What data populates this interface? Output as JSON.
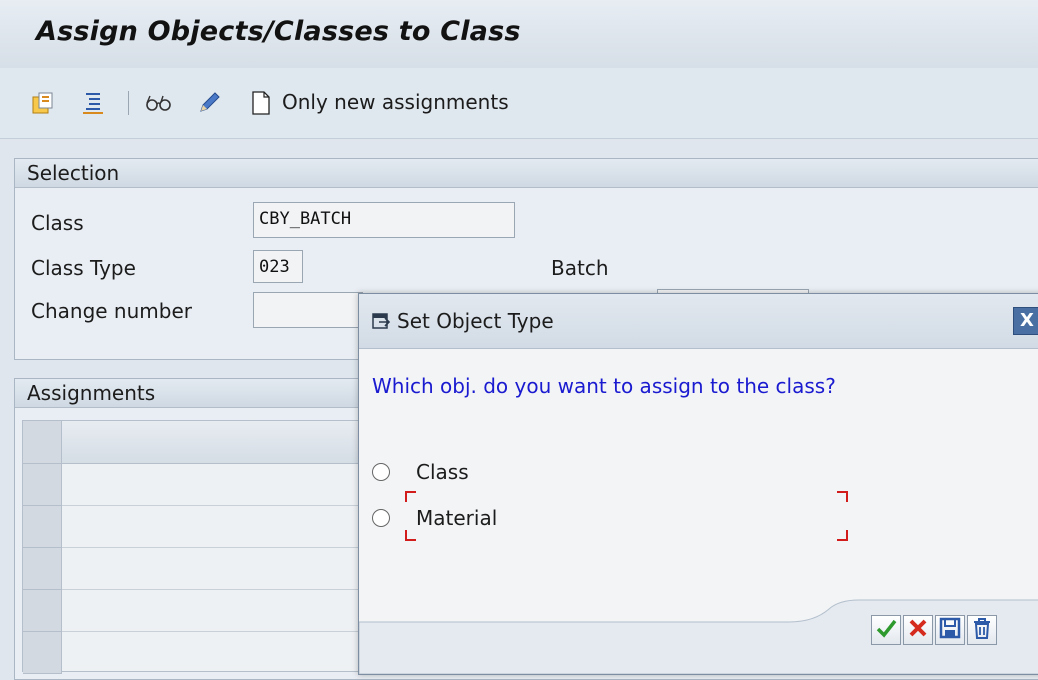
{
  "window": {
    "title": "Assign Objects/Classes to Class"
  },
  "toolbar": {
    "icons": [
      "insert-icon",
      "list-icon",
      "glasses-icon",
      "pencil-icon",
      "document-icon"
    ],
    "only_new_label": "Only new assignments"
  },
  "selection": {
    "header": "Selection",
    "class_label": "Class",
    "class_value": "CBY_BATCH",
    "class_type_label": "Class Type",
    "class_type_value": "023",
    "class_type_text": "Batch",
    "change_number_label": "Change number",
    "change_number_value": ""
  },
  "assignments": {
    "header": "Assignments"
  },
  "dialog": {
    "title": "Set Object Type",
    "question": "Which obj. do you want to assign to the class?",
    "options": [
      {
        "label": "Class",
        "selected": false
      },
      {
        "label": "Material",
        "selected": false
      }
    ],
    "buttons": [
      "continue-icon",
      "cancel-icon",
      "save-icon",
      "delete-icon"
    ],
    "close_glyph": "X"
  },
  "colors": {
    "question_text": "#1a1ad0",
    "focus_frame": "#d21b1b",
    "continue_check": "#2e9a2e",
    "cancel_x": "#d52b1e",
    "button_blue": "#2c5aa8"
  }
}
